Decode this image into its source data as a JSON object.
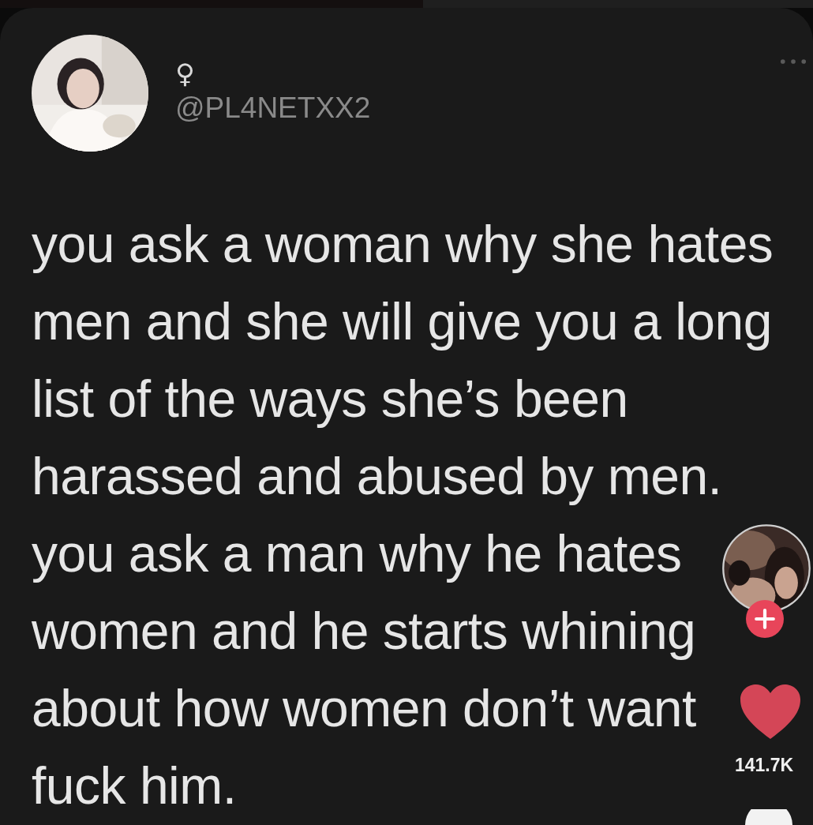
{
  "tweet": {
    "gender_symbol": "♀",
    "handle": "@PL4NETXX2",
    "lines": [
      "you ask a woman why she hates",
      "men and she will give you a long",
      "list of the ways she’s been",
      "harassed and abused by men.",
      "you ask a man why he hates",
      "women and he starts whining",
      "about how women don’t want",
      "fuck him."
    ]
  },
  "side": {
    "likes": "141.7K"
  }
}
